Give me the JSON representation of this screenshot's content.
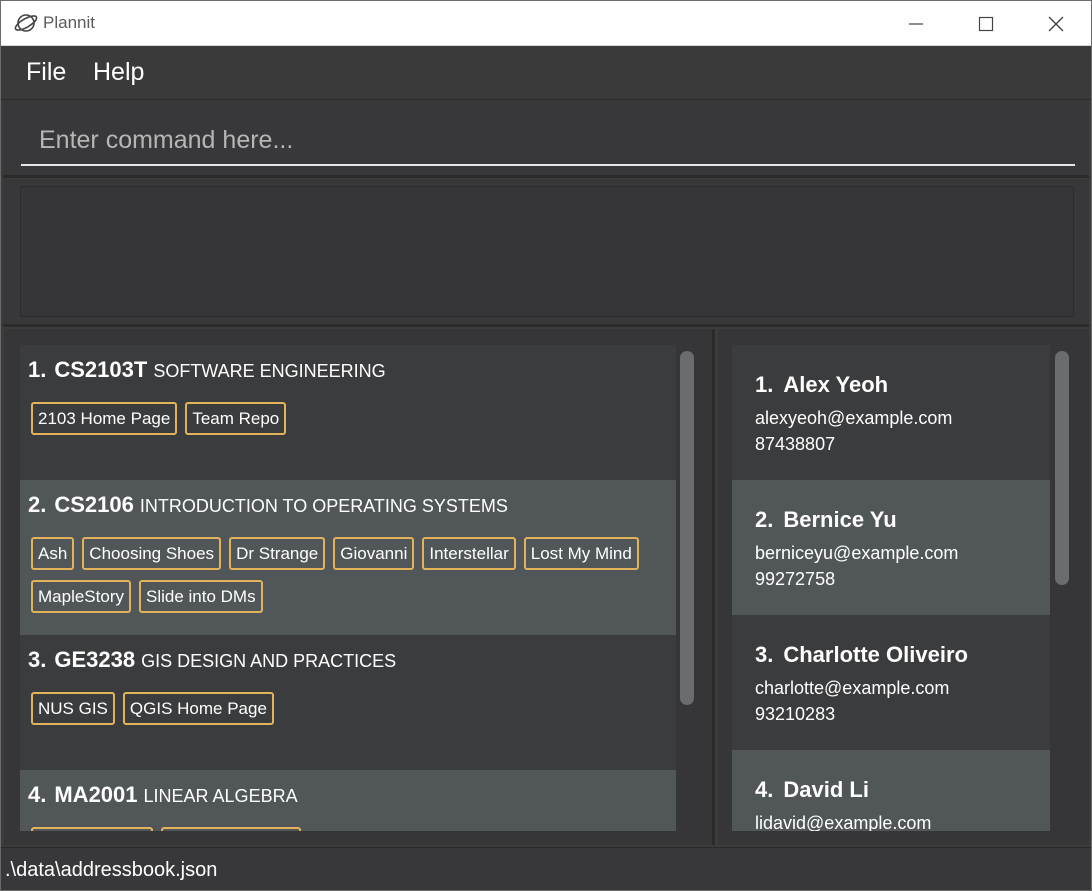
{
  "window": {
    "title": "Plannit"
  },
  "menu": {
    "file": "File",
    "help": "Help"
  },
  "command": {
    "placeholder": "Enter command here...",
    "value": ""
  },
  "result": {
    "text": ""
  },
  "modules": [
    {
      "index": "1.",
      "code": "CS2103T",
      "name": "SOFTWARE ENGINEERING",
      "tags": [
        "2103 Home Page",
        "Team Repo"
      ]
    },
    {
      "index": "2.",
      "code": "CS2106",
      "name": "INTRODUCTION TO OPERATING SYSTEMS",
      "tags": [
        "Ash",
        "Choosing Shoes",
        "Dr Strange",
        "Giovanni",
        "Interstellar",
        "Lost My Mind",
        "MapleStory",
        "Slide into DMs"
      ]
    },
    {
      "index": "3.",
      "code": "GE3238",
      "name": "GIS DESIGN AND PRACTICES",
      "tags": [
        "NUS GIS",
        "QGIS Home Page"
      ]
    },
    {
      "index": "4.",
      "code": "MA2001",
      "name": "LINEAR ALGEBRA",
      "tags": [
        "",
        ""
      ]
    }
  ],
  "persons": [
    {
      "index": "1.",
      "name": "Alex Yeoh",
      "email": "alexyeoh@example.com",
      "phone": "87438807"
    },
    {
      "index": "2.",
      "name": "Bernice Yu",
      "email": "berniceyu@example.com",
      "phone": "99272758"
    },
    {
      "index": "3.",
      "name": "Charlotte Oliveiro",
      "email": "charlotte@example.com",
      "phone": "93210283"
    },
    {
      "index": "4.",
      "name": "David Li",
      "email": "lidavid@example.com",
      "phone": ""
    }
  ],
  "status": {
    "path": ".\\data\\addressbook.json"
  },
  "colors": {
    "tag_border": "#e2b35a",
    "card_dark": "#3b3c3e",
    "card_light": "#515658",
    "background": "#3a3a3b"
  }
}
